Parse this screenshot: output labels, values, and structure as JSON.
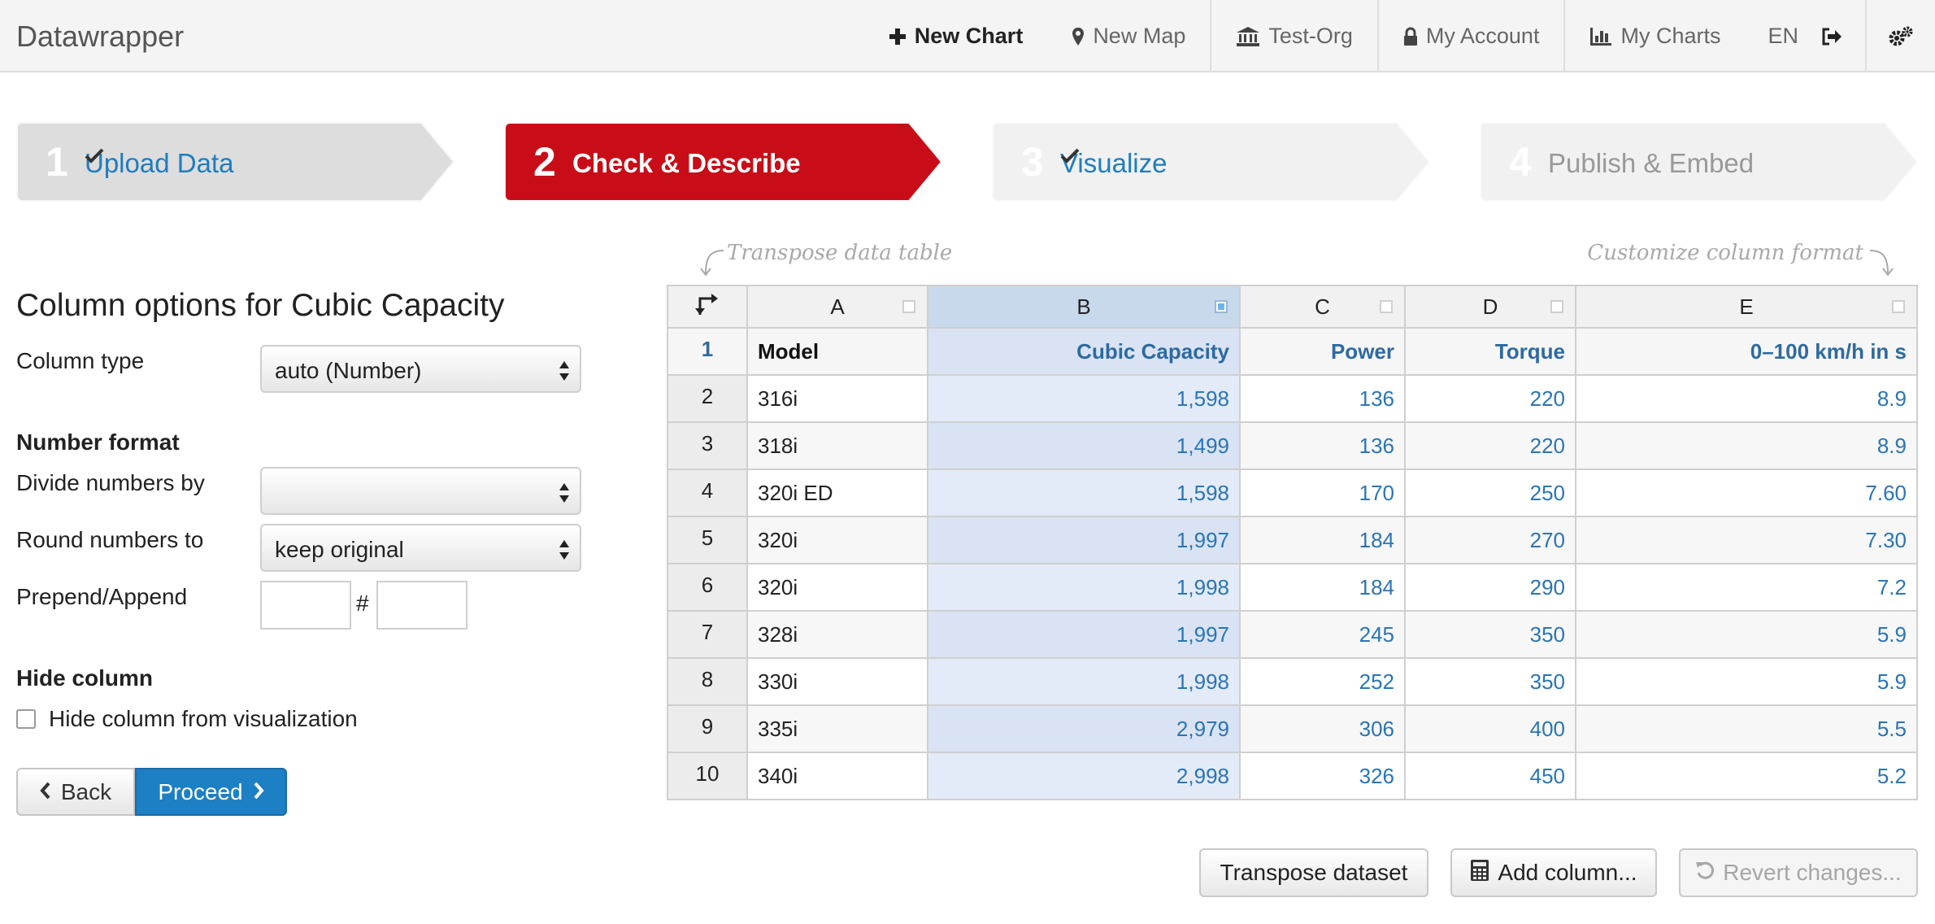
{
  "app": {
    "brand": "Datawrapper"
  },
  "nav": {
    "new_chart": "New Chart",
    "new_map": "New Map",
    "org": "Test-Org",
    "account": "My Account",
    "my_charts": "My Charts",
    "lang": "EN",
    "icons": [
      "plus-icon",
      "map-marker-icon",
      "bank-icon",
      "lock-icon",
      "bar-chart-icon",
      "logout-icon",
      "gears-icon"
    ]
  },
  "steps": [
    {
      "num": "1",
      "label": "Upload Data",
      "state": "done"
    },
    {
      "num": "2",
      "label": "Check & Describe",
      "state": "active"
    },
    {
      "num": "3",
      "label": "Visualize",
      "state": "done"
    },
    {
      "num": "4",
      "label": "Publish & Embed",
      "state": "todo"
    }
  ],
  "colors": {
    "active_step": "#c80d18",
    "link": "#1e7dbf",
    "primary": "#1d7fc4",
    "selected_column": "#e4ebf8"
  },
  "column_options": {
    "title": "Column options for Cubic Capacity",
    "column_type_label": "Column type",
    "column_type_value": "auto (Number)",
    "number_format_heading": "Number format",
    "divide_label": "Divide numbers by",
    "divide_value": "",
    "round_label": "Round numbers to",
    "round_value": "keep original",
    "prepend_label": "Prepend/Append",
    "prepend_value": "",
    "append_value": "",
    "hash": "#",
    "hide_heading": "Hide column",
    "hide_checkbox_label": "Hide column from visualization",
    "hide_checked": false
  },
  "buttons": {
    "back": "Back",
    "proceed": "Proceed",
    "transpose": "Transpose dataset",
    "add_column": "Add column...",
    "revert": "Revert changes..."
  },
  "hints": {
    "transpose": "Transpose data table",
    "customize": "Customize column format"
  },
  "table": {
    "selected_column": "B",
    "column_letters": [
      "A",
      "B",
      "C",
      "D",
      "E"
    ],
    "headers": [
      "Model",
      "Cubic Capacity",
      "Power",
      "Torque",
      "0–100 km/h in s"
    ],
    "row_numbers": [
      "1",
      "2",
      "3",
      "4",
      "5",
      "6",
      "7",
      "8",
      "9",
      "10"
    ],
    "rows": [
      [
        "316i",
        "1,598",
        "136",
        "220",
        "8.9"
      ],
      [
        "318i",
        "1,499",
        "136",
        "220",
        "8.9"
      ],
      [
        "320i ED",
        "1,598",
        "170",
        "250",
        "7.60"
      ],
      [
        "320i",
        "1,997",
        "184",
        "270",
        "7.30"
      ],
      [
        "320i",
        "1,998",
        "184",
        "290",
        "7.2"
      ],
      [
        "328i",
        "1,997",
        "245",
        "350",
        "5.9"
      ],
      [
        "330i",
        "1,998",
        "252",
        "350",
        "5.9"
      ],
      [
        "335i",
        "2,979",
        "306",
        "400",
        "5.5"
      ],
      [
        "340i",
        "2,998",
        "326",
        "450",
        "5.2"
      ]
    ]
  }
}
